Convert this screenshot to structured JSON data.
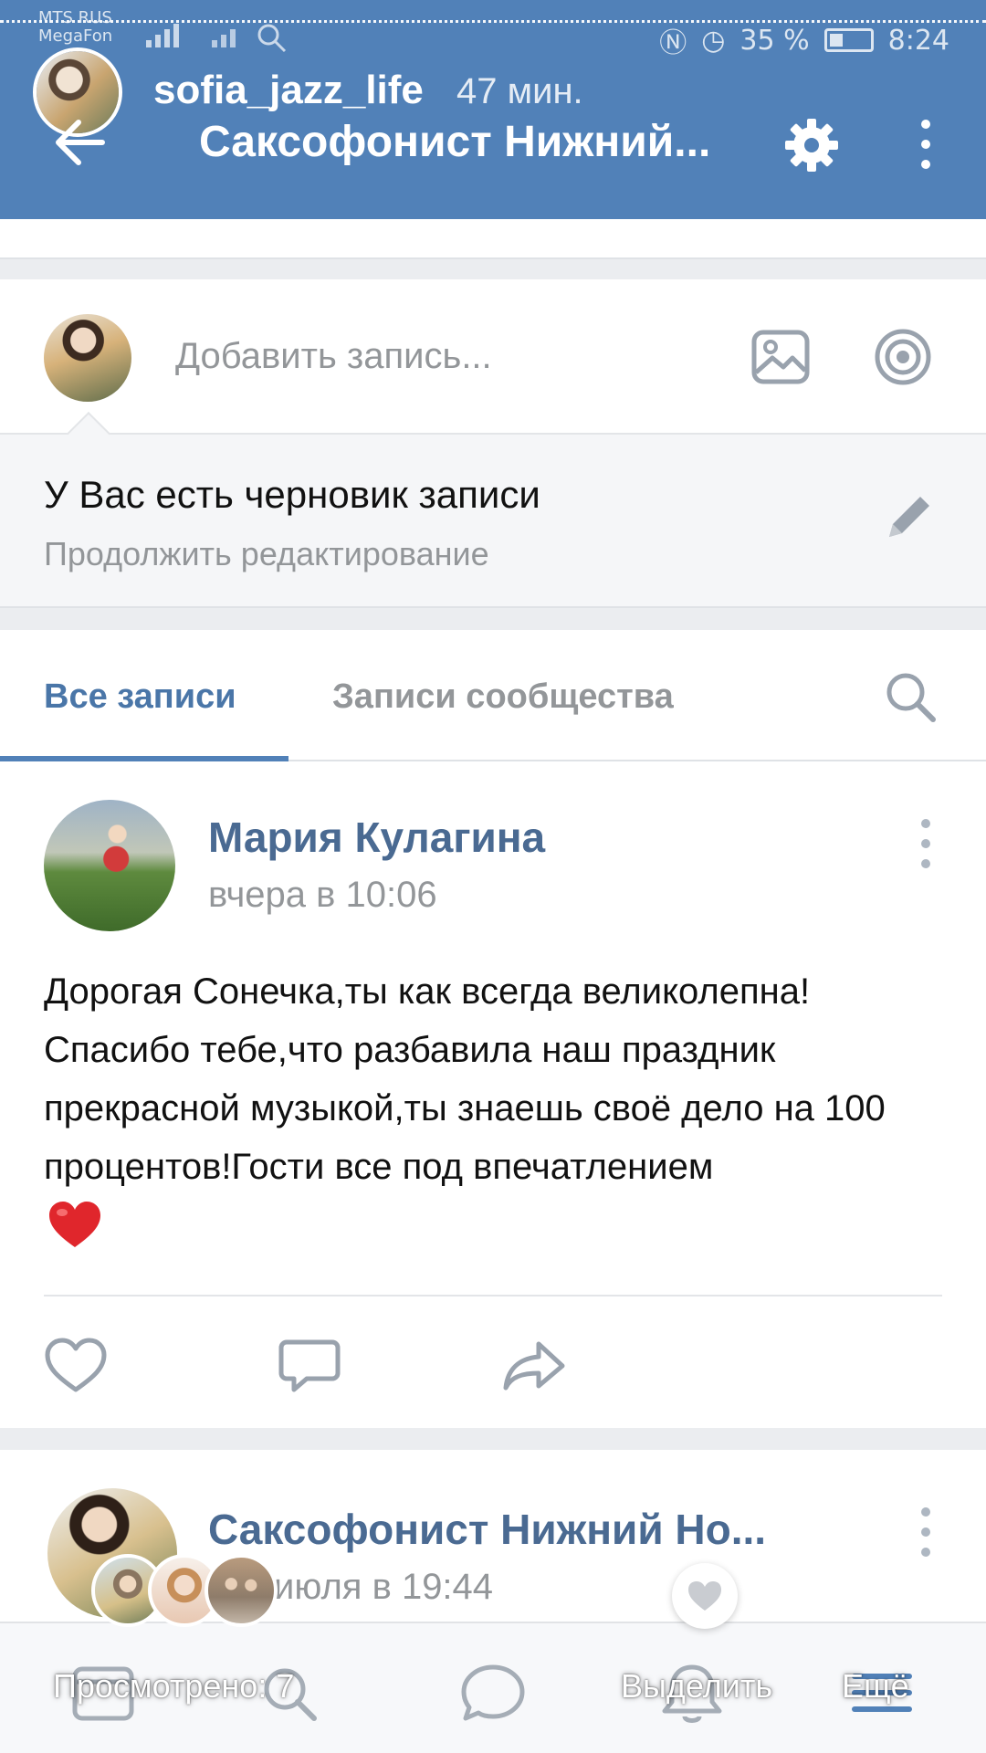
{
  "status_bar": {
    "carrier_1": "MTS RUS",
    "carrier_2": "MegaFon",
    "battery": "35 %",
    "time": "8:24"
  },
  "story_overlay": {
    "username": "sofia_jazz_life",
    "time_ago": "47 мин.",
    "seen_label": "Просмотрено: 7",
    "select_label": "Выделить",
    "more_label": "Ещё"
  },
  "header": {
    "title": "Саксофонист Нижний..."
  },
  "composer": {
    "placeholder": "Добавить запись..."
  },
  "draft": {
    "title": "У Вас есть черновик записи",
    "subtitle": "Продолжить редактирование"
  },
  "tabs": [
    {
      "label": "Все записи",
      "active": true
    },
    {
      "label": "Записи сообщества",
      "active": false
    }
  ],
  "posts": [
    {
      "author": "Мария Кулагина",
      "time": "вчера в 10:06",
      "text": "Дорогая Сонечка,ты как всегда великолепна! Спасибо тебе,что разбавила наш праздник прекрасной музыкой,ты знаешь своё дело на 100 процентов!Гости все под впечатлением",
      "emoji": "heart"
    },
    {
      "author": "Саксофонист Нижний Но...",
      "time": "июля в 19:44"
    }
  ],
  "colors": {
    "header": "#5181b8",
    "link": "#4a76a8",
    "author": "#4a6a92",
    "muted": "#939699"
  },
  "icons": {
    "header": [
      "back-arrow-icon",
      "gear-icon",
      "more-vertical-icon"
    ],
    "composer": [
      "photo-icon",
      "target-icon"
    ],
    "post_actions": [
      "heart-icon",
      "comment-icon",
      "share-icon"
    ],
    "bottom_nav": [
      "news-icon",
      "search-icon",
      "messages-icon",
      "notifications-icon",
      "menu-icon"
    ]
  }
}
